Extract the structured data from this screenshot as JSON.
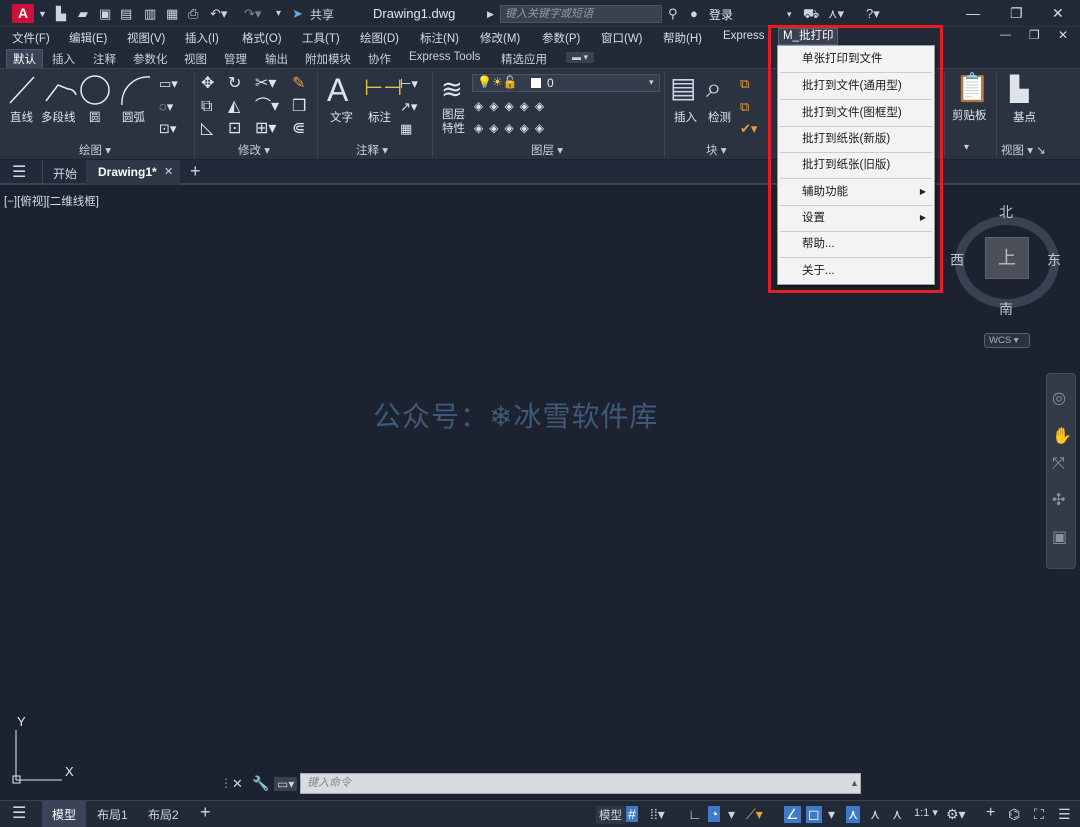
{
  "titlebar": {
    "logo": "A",
    "share": "共享",
    "doc_title": "Drawing1.dwg",
    "search_placeholder": "键入关键字或短语",
    "login": "登录"
  },
  "menubar": {
    "items": [
      "文件(F)",
      "编辑(E)",
      "视图(V)",
      "插入(I)",
      "格式(O)",
      "工具(T)",
      "绘图(D)",
      "标注(N)",
      "修改(M)",
      "参数(P)",
      "窗口(W)",
      "帮助(H)",
      "Express"
    ],
    "active_item": "M_批打印"
  },
  "ribbon_tabs": [
    "默认",
    "插入",
    "注释",
    "参数化",
    "视图",
    "管理",
    "输出",
    "附加模块",
    "协作",
    "Express Tools",
    "精选应用"
  ],
  "ribbon": {
    "draw_tools": [
      "直线",
      "多段线",
      "圆",
      "圆弧"
    ],
    "annotate_tools": [
      "文字",
      "标注"
    ],
    "layer_tool": "图层特性",
    "layer_value": "0",
    "block_tools": [
      "插入",
      "检测"
    ],
    "clipboard": "剪贴板",
    "basepoint": "基点",
    "panel_titles": {
      "draw": "绘图",
      "modify": "修改",
      "annotate": "注释",
      "layers": "图层",
      "block": "块",
      "view": "视图"
    }
  },
  "doctabs": {
    "start": "开始",
    "drawing": "Drawing1*"
  },
  "canvas": {
    "view_label": "[−][俯视][二维线框]",
    "watermark": "公众号：❄冰雪软件库",
    "compass": {
      "north": "北",
      "south": "南",
      "east": "东",
      "west": "西",
      "top": "上"
    },
    "wcs": "WCS",
    "ucs_y": "Y",
    "ucs_x": "X"
  },
  "command": {
    "placeholder": "键入命令"
  },
  "statusbar": {
    "tabs": [
      "模型",
      "布局1",
      "布局2"
    ],
    "model_label": "模型",
    "scale": "1:1"
  },
  "dropdown": {
    "items": [
      {
        "label": "单张打印到文件",
        "submenu": false
      },
      {
        "label": "批打到文件(通用型)",
        "submenu": false
      },
      {
        "label": "批打到文件(图框型)",
        "submenu": false
      },
      {
        "label": "批打到纸张(新版)",
        "submenu": false
      },
      {
        "label": "批打到纸张(旧版)",
        "submenu": false
      },
      {
        "label": "辅助功能",
        "submenu": true
      },
      {
        "label": "设置",
        "submenu": true
      },
      {
        "label": "帮助...",
        "submenu": false
      },
      {
        "label": "关于...",
        "submenu": false
      }
    ]
  },
  "colors": {
    "highlight_border": "#e41e22",
    "logo": "#d0103a",
    "background": "#1c2230"
  }
}
